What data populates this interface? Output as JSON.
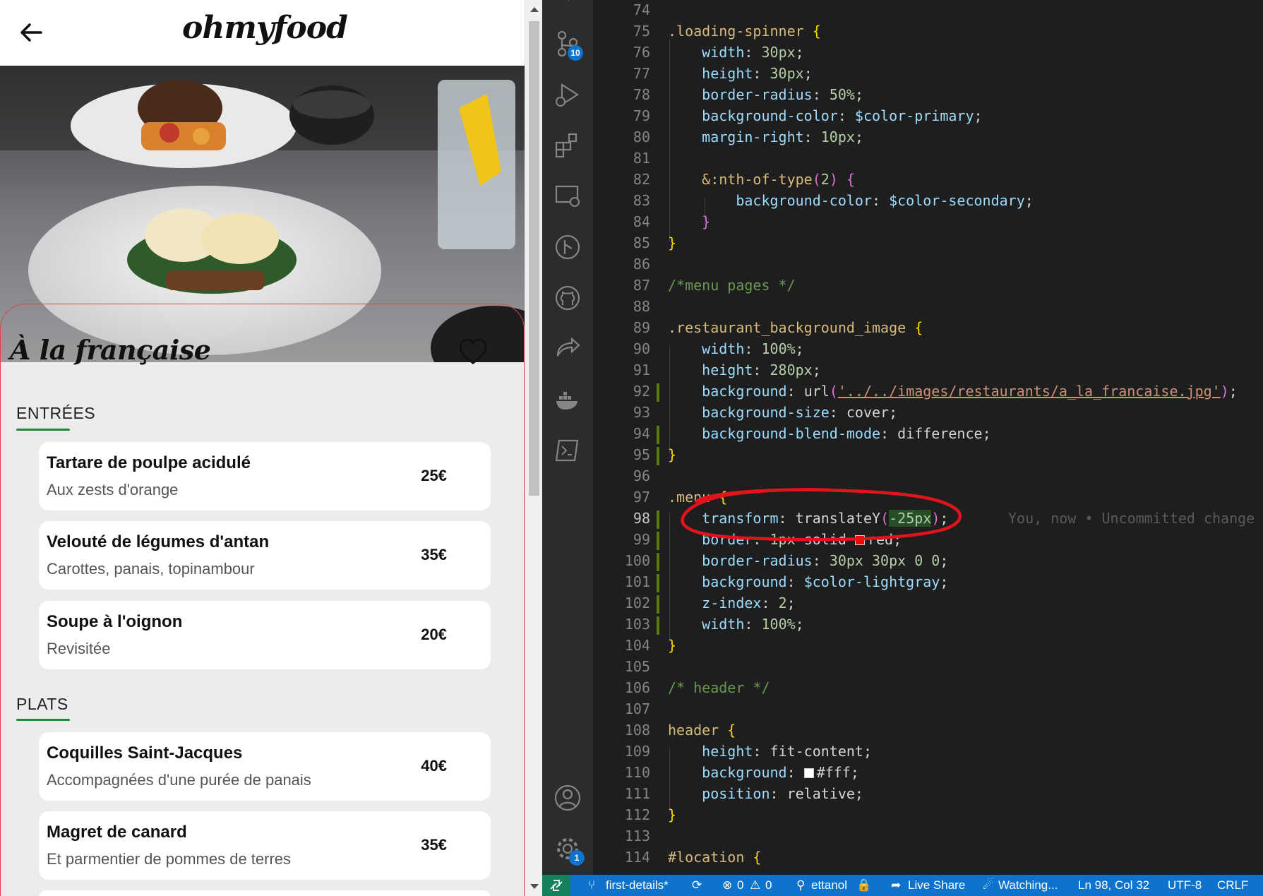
{
  "preview": {
    "logo": "ohmyfood",
    "restaurant_name": "À la française",
    "sections": [
      {
        "title": "ENTRÉES",
        "dishes": [
          {
            "name": "Tartare de poulpe acidulé",
            "desc": "Aux zests d'orange",
            "price": "25€"
          },
          {
            "name": "Velouté de légumes d'antan",
            "desc": "Carottes, panais, topinambour",
            "price": "35€"
          },
          {
            "name": "Soupe à l'oignon",
            "desc": "Revisitée",
            "price": "20€"
          }
        ]
      },
      {
        "title": "PLATS",
        "dishes": [
          {
            "name": "Coquilles Saint-Jacques",
            "desc": "Accompagnées d'une purée de panais",
            "price": "40€"
          },
          {
            "name": "Magret de canard",
            "desc": "Et parmentier de pommes de terres",
            "price": "35€"
          }
        ]
      }
    ],
    "icons": {
      "back": "arrow-left-icon",
      "favorite": "heart-outline-icon"
    }
  },
  "editor": {
    "line_numbers": [
      "74",
      "75",
      "76",
      "77",
      "78",
      "79",
      "80",
      "81",
      "82",
      "83",
      "84",
      "85",
      "86",
      "87",
      "88",
      "89",
      "90",
      "91",
      "92",
      "93",
      "94",
      "95",
      "96",
      "97",
      "98",
      "99",
      "100",
      "101",
      "102",
      "103",
      "104",
      "105",
      "106",
      "107",
      "108",
      "109",
      "110",
      "111",
      "112",
      "113",
      "114"
    ],
    "active_line": "98",
    "code": {
      "l75_sel": ".loading-spinner",
      "l76_prop": "width",
      "l76_val": "30px",
      "l77_prop": "height",
      "l77_val": "30px",
      "l78_prop": "border-radius",
      "l78_val": "50%",
      "l79_prop": "background-color",
      "l79_val": "$color-primary",
      "l80_prop": "margin-right",
      "l80_val": "10px",
      "l82_sel": "&:nth-of-type",
      "l82_arg": "2",
      "l83_prop": "background-color",
      "l83_val": "$color-secondary",
      "l87_cmt": "/*menu pages */",
      "l89_sel": ".restaurant_background_image",
      "l90_prop": "width",
      "l90_val": "100%",
      "l91_prop": "height",
      "l91_val": "280px",
      "l92_prop": "background",
      "l92_fn": "url",
      "l92_str": "'../../images/restaurants/a_la_francaise.jpg'",
      "l93_prop": "background-size",
      "l93_val": "cover",
      "l94_prop": "background-blend-mode",
      "l94_val": "difference",
      "l97_sel": ".menu",
      "l98_prop": "transform",
      "l98_fn": "translateY",
      "l98_val": "-25px",
      "l99_prop": "border",
      "l99_val1": "1px",
      "l99_val2": "solid",
      "l99_color": "red",
      "l100_prop": "border-radius",
      "l100_val": "30px 30px 0 0",
      "l101_prop": "background",
      "l101_val": "$color-lightgray",
      "l102_prop": "z-index",
      "l102_val": "2",
      "l103_prop": "width",
      "l103_val": "100%",
      "l106_cmt": "/* header */",
      "l108_sel": "header",
      "l109_prop": "height",
      "l109_val": "fit-content",
      "l110_prop": "background",
      "l110_color": "#fff",
      "l111_prop": "position",
      "l111_val": "relative",
      "l114_sel": "#location"
    },
    "blame": "You, now • Uncommitted change",
    "annotation_color": "#e2131b",
    "scm_badge": "10",
    "settings_badge": "1"
  },
  "statusbar": {
    "branch": "first-details*",
    "errors": "0",
    "warnings": "0",
    "account": "ettanol",
    "live_share": "Live Share",
    "watching": "Watching...",
    "position": "Ln 98, Col 32",
    "encoding": "UTF-8",
    "eol": "CRLF"
  },
  "colors": {
    "accent_green": "#1d8a2b",
    "status_blue": "#0e73cc",
    "menu_border_red": "#e0424c"
  }
}
